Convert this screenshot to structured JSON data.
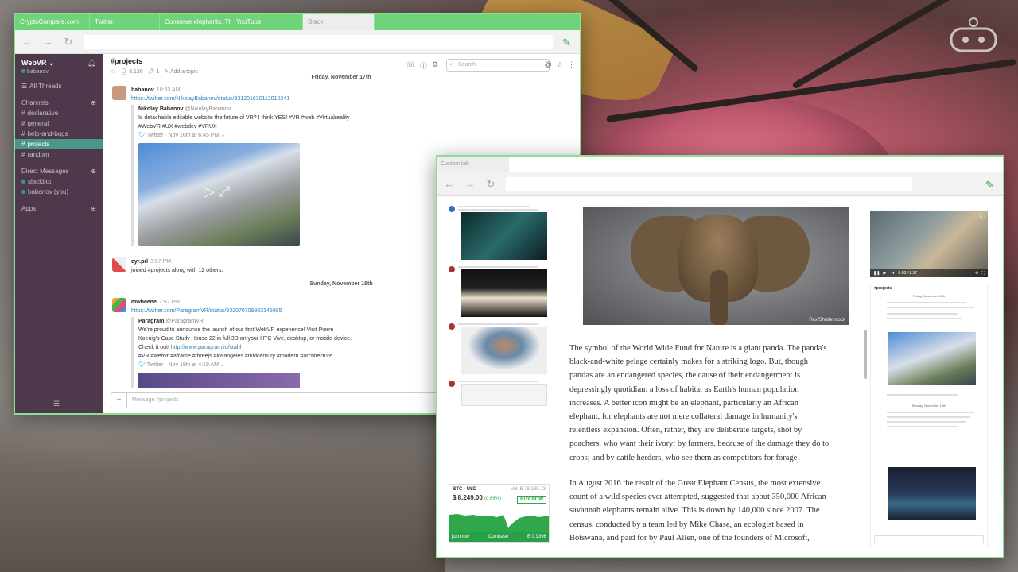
{
  "desktop": {
    "wallpaper": "pink flower on branch, blurred background"
  },
  "browser_tabs": [
    {
      "label": "CryptoCompare.com"
    },
    {
      "label": "Twitter"
    },
    {
      "label": "Conserve elephants. The"
    },
    {
      "label": "YouTube"
    },
    {
      "label": "Slack"
    }
  ],
  "slack": {
    "workspace": "WebVR",
    "user": "babanov",
    "all_threads": "All Threads",
    "channels_header": "Channels",
    "channels": [
      "declarative",
      "general",
      "help-and-bugs",
      "projects",
      "random"
    ],
    "dm_header": "Direct Messages",
    "dms": [
      "slackbot",
      "babanov (you)"
    ],
    "apps_header": "Apps",
    "channel_title": "#projects",
    "members": "3,126",
    "pins": "1",
    "add_topic": "Add a topic",
    "search_placeholder": "Search",
    "day1": "Friday, November 17th",
    "day2": "Sunday, November 19th",
    "msg1": {
      "author": "babanov",
      "time": "10:53 AM",
      "link": "https://twitter.com/NikolayBabanov/status/931201630112010241",
      "quote_author": "Nikolay Babanov",
      "quote_handle": "@NikolayBabanov",
      "quote_text": "Is detachable editable website the future of VR? I think YES! #VR #web #Virtualreality",
      "quote_tags": "#WebVR #UX #webdev #VRUX",
      "quote_meta": "Twitter · Nov 16th at 6:45 PM"
    },
    "msg2": {
      "author": "cyr.prl",
      "time": "3:57 PM",
      "text": "joined #projects along with 12 others."
    },
    "msg3": {
      "author": "mwbeene",
      "time": "7:52 PM",
      "link": "https://twitter.com/ParagramVR/status/932070709983145985",
      "quote_author": "Paragram",
      "quote_handle": "@ParagramVR",
      "quote_text1": "We're proud to announce the launch of our first WebVR experience! Visit Pierre",
      "quote_text2": "Koenig's Case Study House 22 in full 3D on your HTC Vive, desktop, or mobile device.",
      "quote_text3": "Check it out!",
      "quote_link": "http://www.paragram.io/stahl",
      "quote_tags": "#VR #webvr #aframe #threejs #losangeles #midcentury #modern #architecture",
      "quote_meta": "Twitter · Nov 19th at 4:19 AM"
    },
    "composer_placeholder": "Message #projects"
  },
  "custom_tab": {
    "tab_label": "Custom tab",
    "image_credit": "Rex/Shutterstock",
    "para1_lines": [
      "The symbol of the World Wide Fund for Nature is a giant panda. The panda's",
      "black-and-white pelage certainly makes for a striking logo. But, though",
      "pandas are an endangered species, the cause of their endangerment is",
      "depressingly quotidian: a loss of habitat as Earth's human population",
      "increases. A better icon might be an elephant, particularly an African",
      "elephant, for elephants are not mere collateral damage in humanity's",
      "relentless expansion. Often, rather, they are deliberate targets, shot by",
      "poachers, who want their ivory; by farmers, because of the damage they do to",
      "crops; and by cattle herders, who see them as competitors for forage."
    ],
    "para2_lines": [
      "In August 2016 the result of the Great Elephant Census, the most extensive",
      "count of a wild species ever attempted, suggested that about 350,000 African",
      "savannah elephants remain alive. This is down by 140,000 since 2007. The",
      "census, conducted by a team led by Mike Chase, an ecologist based in",
      "Botswana, and paid for by Paul Allen, one of the founders of Microsoft,"
    ],
    "btc": {
      "pair": "BTC - USD",
      "vol": "Vol: B 78,189.73",
      "price": "$ 8,249.00",
      "change": "(0.66%)",
      "buy": "BUY NOW",
      "foot_left": "just now",
      "foot_mid": "Coinbase",
      "foot_right": "B 0.9396"
    },
    "video_time": "0:08 / 2:57",
    "mini_title": "#projects",
    "mini_day": "Friday, November 17th",
    "mini_day2": "Sunday, November 19th"
  },
  "colors": {
    "accent_green": "#6fd37a",
    "slack_sidebar": "#4d394b",
    "active_channel": "#4c9689"
  }
}
